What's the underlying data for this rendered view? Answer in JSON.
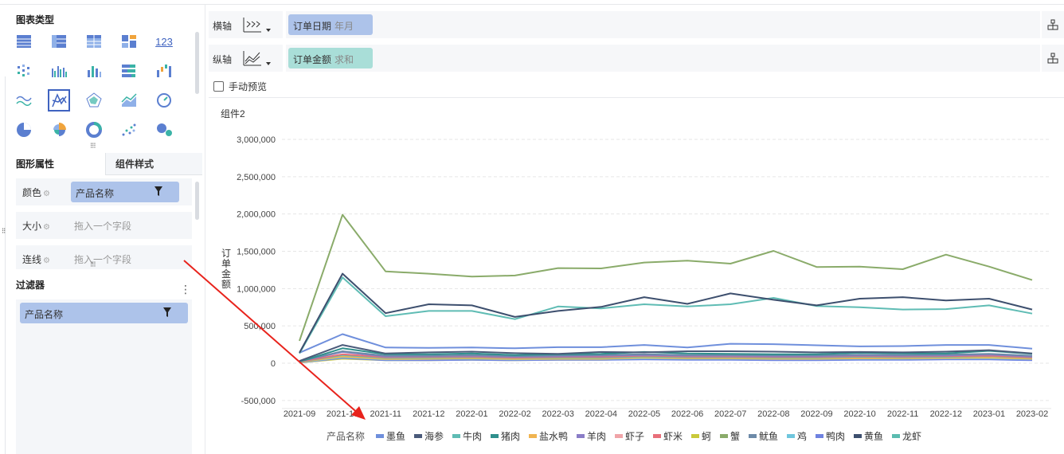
{
  "left": {
    "chart_types_title": "图表类型",
    "chart_types": [
      {
        "name": "table-icon"
      },
      {
        "name": "cross-table-icon"
      },
      {
        "name": "detail-table-icon"
      },
      {
        "name": "tile-icon"
      },
      {
        "name": "kpi-number-icon",
        "text": "123"
      },
      {
        "name": "scatter-bar-icon"
      },
      {
        "name": "grouped-bar-icon"
      },
      {
        "name": "column-icon"
      },
      {
        "name": "stacked-bar-icon"
      },
      {
        "name": "waterfall-icon"
      },
      {
        "name": "curve-icon"
      },
      {
        "name": "line-icon",
        "selected": true
      },
      {
        "name": "radar-icon"
      },
      {
        "name": "area-icon"
      },
      {
        "name": "gauge-icon"
      },
      {
        "name": "pie-icon"
      },
      {
        "name": "rose-pie-icon"
      },
      {
        "name": "donut-icon"
      },
      {
        "name": "scatter-icon"
      },
      {
        "name": "bubble-icon"
      }
    ],
    "tabs": {
      "graph_props": "图形属性",
      "component_style": "组件样式"
    },
    "props": {
      "color_label": "颜色",
      "color_field": "产品名称",
      "size_label": "大小",
      "size_placeholder": "拖入一个字段",
      "line_label": "连线",
      "line_placeholder": "拖入一个字段"
    },
    "filter": {
      "title": "过滤器",
      "field": "产品名称"
    }
  },
  "axes": {
    "x_label": "横轴",
    "x_field": "订单日期",
    "x_field_sub": "年月",
    "y_label": "纵轴",
    "y_field": "订单金额",
    "y_field_sub": "求和"
  },
  "manual_preview": "手动预览",
  "chart_data": {
    "type": "line",
    "title": "组件2",
    "ylabel": "订单金额",
    "ylim": [
      -500000,
      3000000
    ],
    "yticks": [
      "3,000,000",
      "2,500,000",
      "2,000,000",
      "1,500,000",
      "1,000,000",
      "500,000",
      "0",
      "-500,000"
    ],
    "ytick_values": [
      3000000,
      2500000,
      2000000,
      1500000,
      1000000,
      500000,
      0,
      -500000
    ],
    "categories": [
      "2021-09",
      "2021-10",
      "2021-11",
      "2021-12",
      "2022-01",
      "2022-02",
      "2022-03",
      "2022-04",
      "2022-05",
      "2022-06",
      "2022-07",
      "2022-08",
      "2022-09",
      "2022-10",
      "2022-11",
      "2022-12",
      "2023-01",
      "2023-02"
    ],
    "legend_title": "产品名称",
    "series": [
      {
        "name": "墨鱼",
        "color": "#6f8fdc",
        "values": [
          140000,
          390000,
          210000,
          205000,
          210000,
          200000,
          215000,
          215000,
          245000,
          210000,
          260000,
          255000,
          240000,
          225000,
          230000,
          245000,
          245000,
          195000
        ]
      },
      {
        "name": "海参",
        "color": "#4a5a7a",
        "values": [
          30000,
          245000,
          130000,
          145000,
          155000,
          135000,
          125000,
          150000,
          145000,
          160000,
          160000,
          155000,
          145000,
          150000,
          145000,
          155000,
          175000,
          130000
        ]
      },
      {
        "name": "牛肉",
        "color": "#5fbcb4",
        "values": [
          130000,
          1150000,
          630000,
          700000,
          700000,
          590000,
          760000,
          735000,
          790000,
          760000,
          790000,
          875000,
          765000,
          750000,
          720000,
          725000,
          775000,
          665000
        ]
      },
      {
        "name": "猪肉",
        "color": "#2f8f8c",
        "values": [
          20000,
          200000,
          120000,
          120000,
          130000,
          110000,
          120000,
          125000,
          150000,
          130000,
          125000,
          120000,
          120000,
          140000,
          130000,
          130000,
          165000,
          125000
        ]
      },
      {
        "name": "盐水鸭",
        "color": "#f0b451",
        "values": [
          15000,
          90000,
          55000,
          60000,
          65000,
          55000,
          60000,
          60000,
          75000,
          65000,
          65000,
          60000,
          60000,
          65000,
          65000,
          70000,
          75000,
          60000
        ]
      },
      {
        "name": "羊肉",
        "color": "#8a7dc7",
        "values": [
          25000,
          150000,
          90000,
          95000,
          100000,
          85000,
          95000,
          100000,
          110000,
          100000,
          100000,
          95000,
          95000,
          105000,
          100000,
          105000,
          115000,
          90000
        ]
      },
      {
        "name": "虾子",
        "color": "#f0a4a8",
        "values": [
          10000,
          70000,
          45000,
          50000,
          55000,
          45000,
          50000,
          50000,
          60000,
          55000,
          55000,
          50000,
          50000,
          55000,
          55000,
          60000,
          60000,
          50000
        ]
      },
      {
        "name": "虾米",
        "color": "#e86f7a",
        "values": [
          20000,
          120000,
          80000,
          85000,
          90000,
          75000,
          85000,
          85000,
          100000,
          90000,
          90000,
          85000,
          85000,
          95000,
          90000,
          95000,
          100000,
          80000
        ]
      },
      {
        "name": "蚵",
        "color": "#c9c93a",
        "values": [
          8000,
          60000,
          40000,
          40000,
          45000,
          40000,
          45000,
          45000,
          55000,
          50000,
          50000,
          45000,
          45000,
          50000,
          50000,
          55000,
          55000,
          45000
        ]
      },
      {
        "name": "蟹",
        "color": "#8aab6a",
        "values": [
          300000,
          1990000,
          1230000,
          1200000,
          1160000,
          1175000,
          1275000,
          1270000,
          1350000,
          1375000,
          1335000,
          1505000,
          1290000,
          1295000,
          1260000,
          1455000,
          1295000,
          1115000
        ]
      },
      {
        "name": "鱿鱼",
        "color": "#6d8aa8",
        "values": [
          25000,
          160000,
          100000,
          100000,
          110000,
          95000,
          105000,
          110000,
          120000,
          110000,
          110000,
          105000,
          105000,
          115000,
          110000,
          115000,
          125000,
          100000
        ]
      },
      {
        "name": "鸡",
        "color": "#6fc6dd",
        "values": [
          12000,
          80000,
          50000,
          55000,
          60000,
          50000,
          55000,
          55000,
          65000,
          60000,
          60000,
          55000,
          55000,
          60000,
          60000,
          65000,
          65000,
          55000
        ]
      },
      {
        "name": "鸭肉",
        "color": "#6f82e0",
        "values": [
          10000,
          70000,
          40000,
          40000,
          45000,
          40000,
          45000,
          45000,
          50000,
          45000,
          45000,
          40000,
          40000,
          45000,
          45000,
          50000,
          50000,
          40000
        ]
      },
      {
        "name": "黄鱼",
        "color": "#3d4f6e",
        "values": [
          140000,
          1200000,
          670000,
          790000,
          775000,
          620000,
          700000,
          755000,
          885000,
          795000,
          935000,
          850000,
          775000,
          865000,
          885000,
          840000,
          865000,
          720000
        ]
      },
      {
        "name": "龙虾",
        "color": "#5bbcb0",
        "values": [
          18000,
          110000,
          70000,
          75000,
          80000,
          70000,
          75000,
          75000,
          90000,
          80000,
          80000,
          75000,
          75000,
          85000,
          80000,
          85000,
          95000,
          75000
        ]
      }
    ]
  }
}
